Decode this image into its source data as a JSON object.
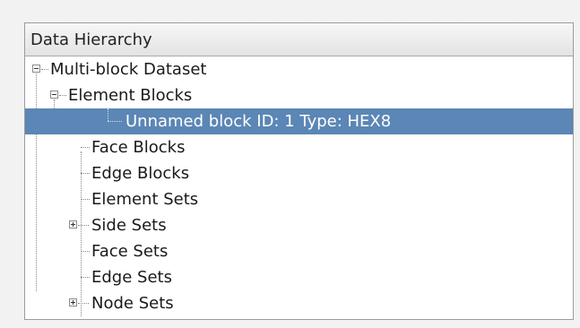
{
  "panel": {
    "header": "Data Hierarchy"
  },
  "tree": {
    "root": "Multi-block Dataset",
    "element_blocks": "Element Blocks",
    "unnamed_block": "Unnamed block ID: 1 Type: HEX8",
    "face_blocks": "Face Blocks",
    "edge_blocks": "Edge Blocks",
    "element_sets": "Element Sets",
    "side_sets": "Side Sets",
    "face_sets": "Face Sets",
    "edge_sets": "Edge Sets",
    "node_sets": "Node Sets"
  },
  "colors": {
    "selection": "#5b86b5",
    "panel_bg": "#ffffff",
    "page_bg": "#f2f2f2"
  }
}
